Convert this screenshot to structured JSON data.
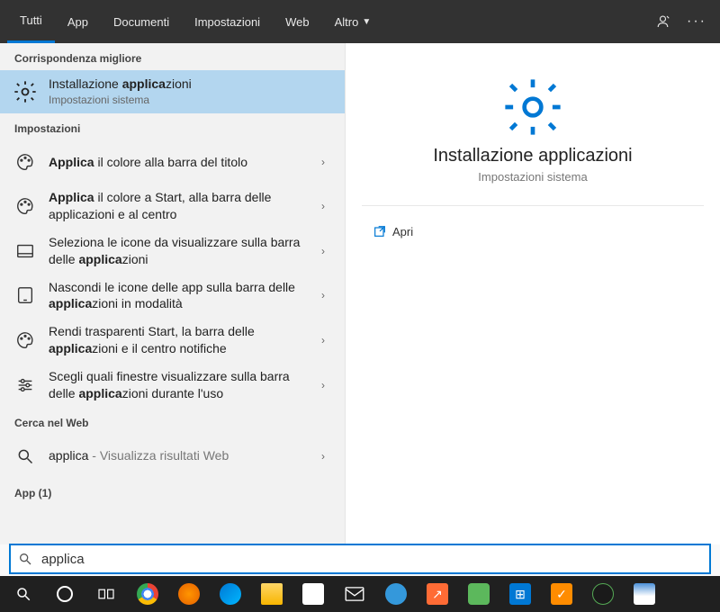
{
  "tabs": {
    "all": "Tutti",
    "apps": "App",
    "documents": "Documenti",
    "settings": "Impostazioni",
    "web": "Web",
    "more": "Altro"
  },
  "sections": {
    "best_match": "Corrispondenza migliore",
    "settings": "Impostazioni",
    "web": "Cerca nel Web",
    "apps": "App (1)"
  },
  "best": {
    "title": "Installazione applicazioni",
    "subtitle": "Impostazioni sistema"
  },
  "settings_items": [
    {
      "html": "<b>Applica</b> il colore alla barra del titolo"
    },
    {
      "html": "<b>Applica</b> il colore a Start, alla barra delle applicazioni e al centro"
    },
    {
      "html": "Seleziona le icone da visualizzare sulla barra delle <b>applica</b>zioni"
    },
    {
      "html": "Nascondi le icone delle app sulla barra delle <b>applica</b>zioni in modalità"
    },
    {
      "html": "Rendi trasparenti Start, la barra delle <b>applica</b>zioni e il centro notifiche"
    },
    {
      "html": "Scegli quali finestre visualizzare sulla barra delle <b>applica</b>zioni durante l'uso"
    }
  ],
  "web_item": {
    "term": "applica",
    "suffix": " - Visualizza risultati Web"
  },
  "preview": {
    "title": "Installazione applicazioni",
    "subtitle": "Impostazioni sistema",
    "action_open": "Apri"
  },
  "search": {
    "value": "applica"
  },
  "colors": {
    "accent": "#0078d4"
  }
}
